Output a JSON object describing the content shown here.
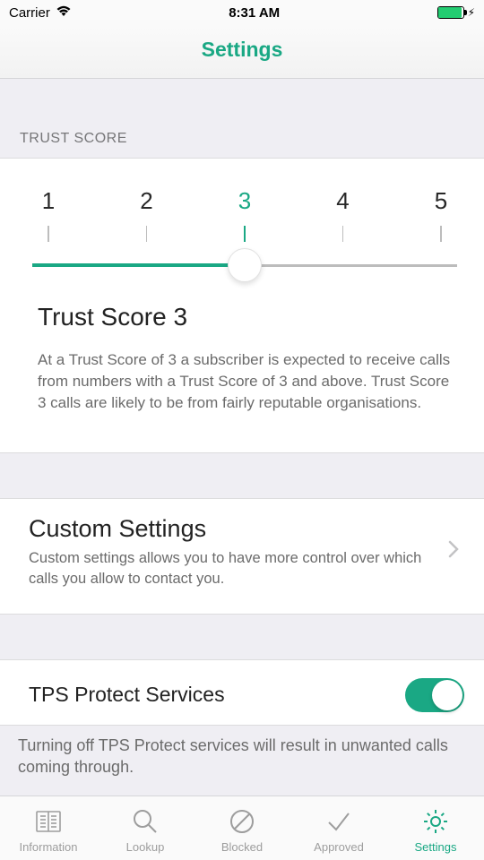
{
  "status_bar": {
    "carrier": "Carrier",
    "time": "8:31 AM"
  },
  "header": {
    "title": "Settings"
  },
  "trust_section": {
    "label": "TRUST SCORE",
    "scale": [
      "1",
      "2",
      "3",
      "4",
      "5"
    ],
    "selected_value": "3",
    "title": "Trust Score 3",
    "description": "At a Trust Score of 3 a subscriber is expected to receive calls from numbers with a Trust Score of 3 and above. Trust Score 3 calls are likely to be from fairly reputable organisations."
  },
  "custom_section": {
    "title": "Custom Settings",
    "description": "Custom settings allows you to have more control over which calls you allow to contact you."
  },
  "tps_section": {
    "title": "TPS Protect Services",
    "enabled": true,
    "description": "Turning off TPS Protect services will result in unwanted calls coming through."
  },
  "tabs": {
    "items": [
      {
        "label": "Information"
      },
      {
        "label": "Lookup"
      },
      {
        "label": "Blocked"
      },
      {
        "label": "Approved"
      },
      {
        "label": "Settings"
      }
    ],
    "active_index": 4
  },
  "colors": {
    "accent": "#1aa884"
  }
}
